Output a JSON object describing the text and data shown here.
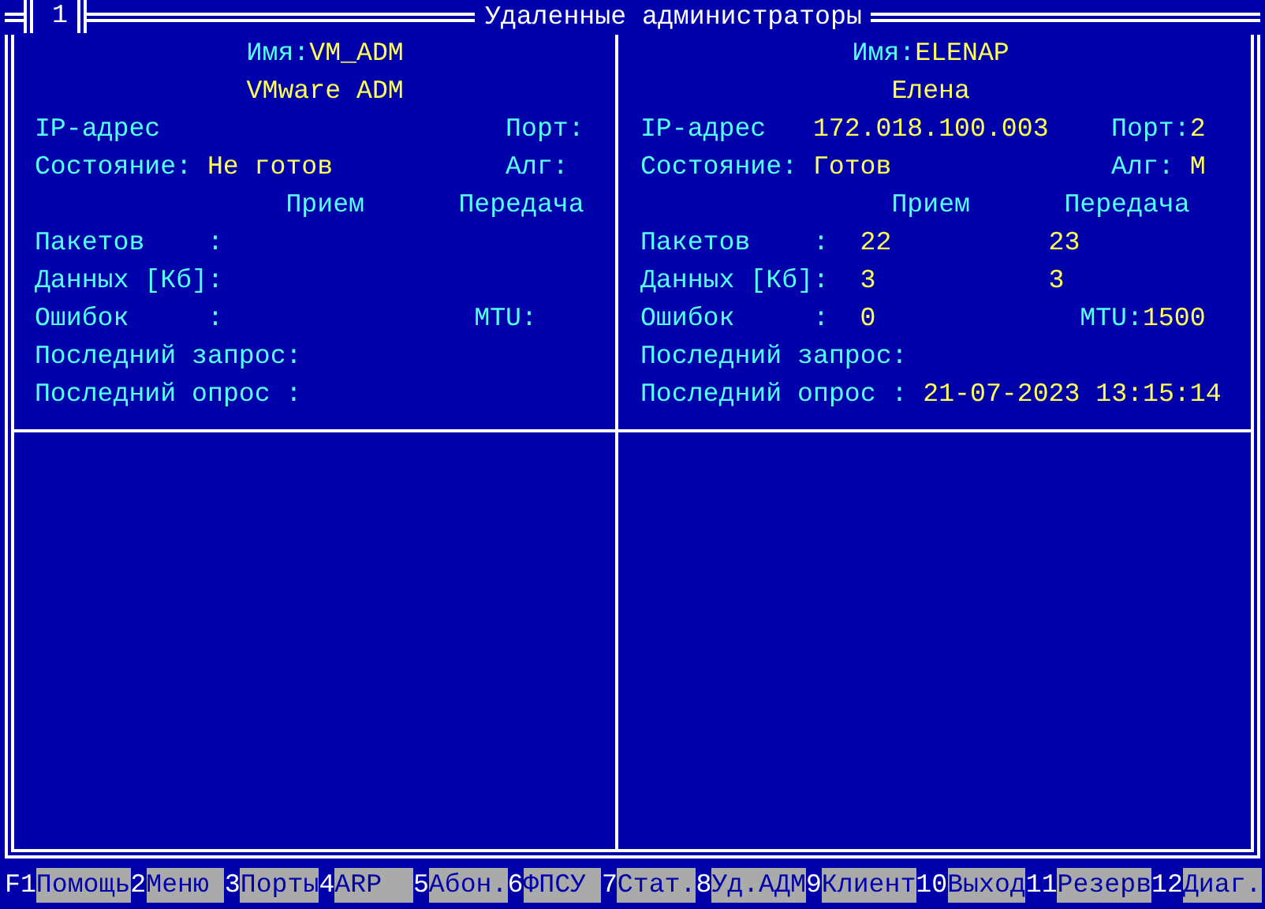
{
  "tab": "1",
  "title": "Удаленные администраторы",
  "panels": [
    {
      "name_label": "Имя:",
      "name": "VM_ADM",
      "description": "VMware ADM",
      "ip_label": "IP-адрес",
      "port_label": "Порт:",
      "state_label": "Состояние:",
      "state": "Не готов",
      "algorithm_label": "Алг:",
      "rx_header": "Прием",
      "tx_header": "Передача",
      "packets_label": "Пакетов",
      "packets_sep": ":",
      "data_label": "Данных [Кб]:",
      "errors_label": "Ошибок",
      "errors_sep": ":",
      "mtu_label": "MTU:",
      "last_request_label": "Последний запрос:",
      "last_poll_label": "Последний опрос :"
    },
    {
      "name_label": "Имя:",
      "name": "ELENAP",
      "description": "Елена",
      "ip_label": "IP-адрес",
      "ip": "172.018.100.003",
      "port_label": "Порт:",
      "port": "2",
      "state_label": "Состояние:",
      "state": "Готов",
      "algorithm_label": "Алг:",
      "algorithm": "M",
      "rx_header": "Прием",
      "tx_header": "Передача",
      "packets_label": "Пакетов",
      "packets_sep": ":",
      "packets_rx": "22",
      "packets_tx": "23",
      "data_label": "Данных [Кб]:",
      "data_rx": "3",
      "data_tx": "3",
      "errors_label": "Ошибок",
      "errors_sep": ":",
      "errors": "0",
      "mtu_label": "MTU:",
      "mtu": "1500",
      "last_request_label": "Последний запрос:",
      "last_poll_label": "Последний опрос :",
      "last_poll": "21-07-2023 13:15:14"
    }
  ],
  "function_keys": [
    {
      "key": "F1",
      "label": "Помощь"
    },
    {
      "key": "2",
      "label": "Меню"
    },
    {
      "key": "3",
      "label": "Порты"
    },
    {
      "key": "4",
      "label": "ARP"
    },
    {
      "key": "5",
      "label": "Абон."
    },
    {
      "key": "6",
      "label": "ФПСУ"
    },
    {
      "key": "7",
      "label": "Стат."
    },
    {
      "key": "8",
      "label": "Уд.АДМ"
    },
    {
      "key": "9",
      "label": "Клиент"
    },
    {
      "key": "10",
      "label": "Выход"
    },
    {
      "key": "11",
      "label": "Резерв"
    },
    {
      "key": "12",
      "label": "Диаг."
    }
  ]
}
